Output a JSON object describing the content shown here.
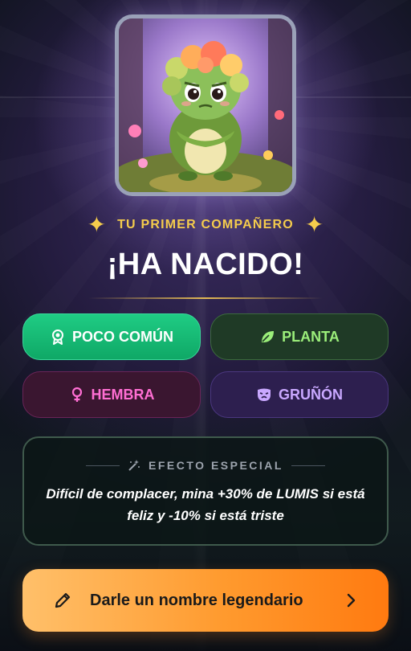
{
  "portrait": {
    "icon": "creature-portrait"
  },
  "header": {
    "subtitle": "TU PRIMER COMPAÑERO",
    "title": "¡HA NACIDO!",
    "sparkle_glyph": "✦"
  },
  "badges": {
    "rarity": {
      "label": "POCO COMÚN",
      "icon": "medal-icon",
      "color": "#1fcc84"
    },
    "type": {
      "label": "PLANTA",
      "icon": "leaf-icon",
      "color": "#9bee7a"
    },
    "gender": {
      "label": "HEMBRA",
      "icon": "female-icon",
      "color": "#ff6ed3"
    },
    "mood": {
      "label": "GRUÑÓN",
      "icon": "mask-icon",
      "color": "#c9a8ff"
    }
  },
  "effect": {
    "heading": "EFECTO ESPECIAL",
    "text": "Difícil de complacer, mina +30% de LUMIS si está feliz y -10% si está triste",
    "icon": "magic-wand-icon"
  },
  "cta": {
    "label": "Darle un nombre legendario",
    "icon": "pencil-icon",
    "trailing_icon": "chevron-right-icon"
  }
}
